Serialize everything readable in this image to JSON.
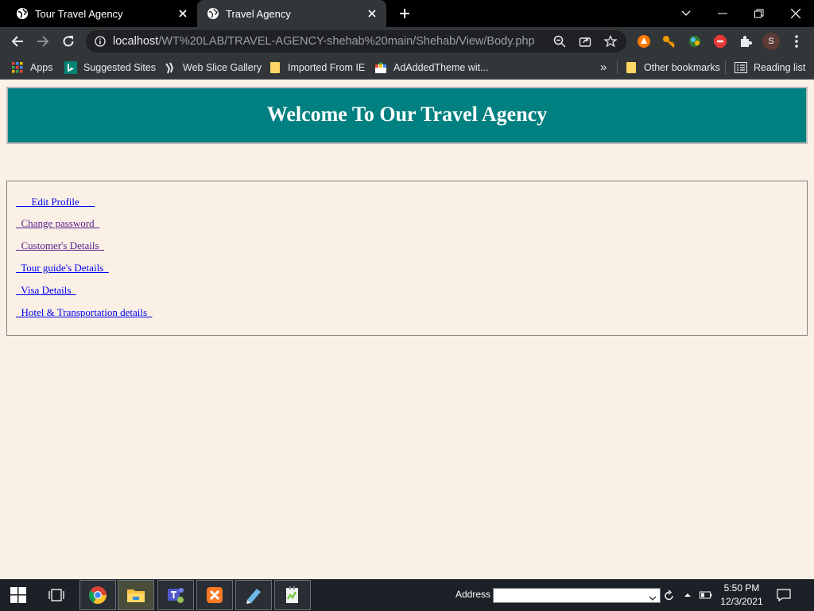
{
  "browser": {
    "tabs": [
      {
        "title": "Tour Travel Agency",
        "active": false
      },
      {
        "title": "Travel Agency",
        "active": true
      }
    ],
    "url": {
      "host": "localhost",
      "path": "/WT%20LAB/TRAVEL-AGENCY-shehab%20main/Shehab/View/Body.php"
    },
    "profile_initial": "S",
    "bookmarks": [
      {
        "label": "Apps",
        "icon": "apps-grid-icon"
      },
      {
        "label": "Suggested Sites",
        "icon": "bing-icon"
      },
      {
        "label": "Web Slice Gallery",
        "icon": "web-slice-icon"
      },
      {
        "label": "Imported From IE",
        "icon": "folder-icon"
      },
      {
        "label": "AdAddedTheme wit...",
        "icon": "theme-icon"
      }
    ],
    "bookmarks_overflow": "»",
    "other_bookmarks": "Other bookmarks",
    "reading_list": "Reading list"
  },
  "page": {
    "heading": "Welcome To Our Travel Agency",
    "header_bg": "#008080",
    "body_bg": "#faf0e6",
    "menu": [
      {
        "label": "      Edit Profile      ",
        "visited": false
      },
      {
        "label": "  Change password  ",
        "visited": true
      },
      {
        "label": "  Customer's Details  ",
        "visited": true
      },
      {
        "label": "  Tour guide's Details  ",
        "visited": false
      },
      {
        "label": "  Visa Details  ",
        "visited": false
      },
      {
        "label": "  Hotel & Transportation details  ",
        "visited": false
      }
    ]
  },
  "taskbar": {
    "address_label": "Address",
    "time": "5:50 PM",
    "date": "12/3/2021"
  }
}
